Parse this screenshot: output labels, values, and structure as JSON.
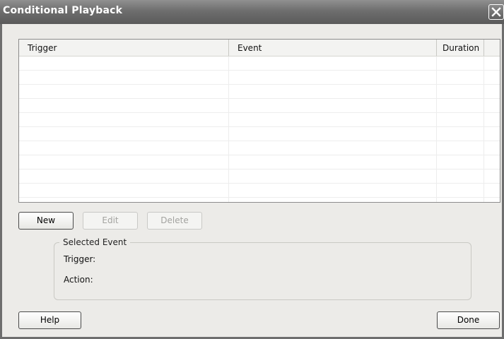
{
  "window": {
    "title": "Conditional Playback"
  },
  "table": {
    "columns": [
      "Trigger",
      "Event",
      "Duration"
    ],
    "rows": []
  },
  "buttons": {
    "new": "New",
    "edit": "Edit",
    "delete": "Delete",
    "help": "Help",
    "done": "Done"
  },
  "selected_event": {
    "title": "Selected Event",
    "trigger_label": "Trigger:",
    "action_label": "Action:"
  },
  "icons": {
    "close": "close-icon"
  }
}
